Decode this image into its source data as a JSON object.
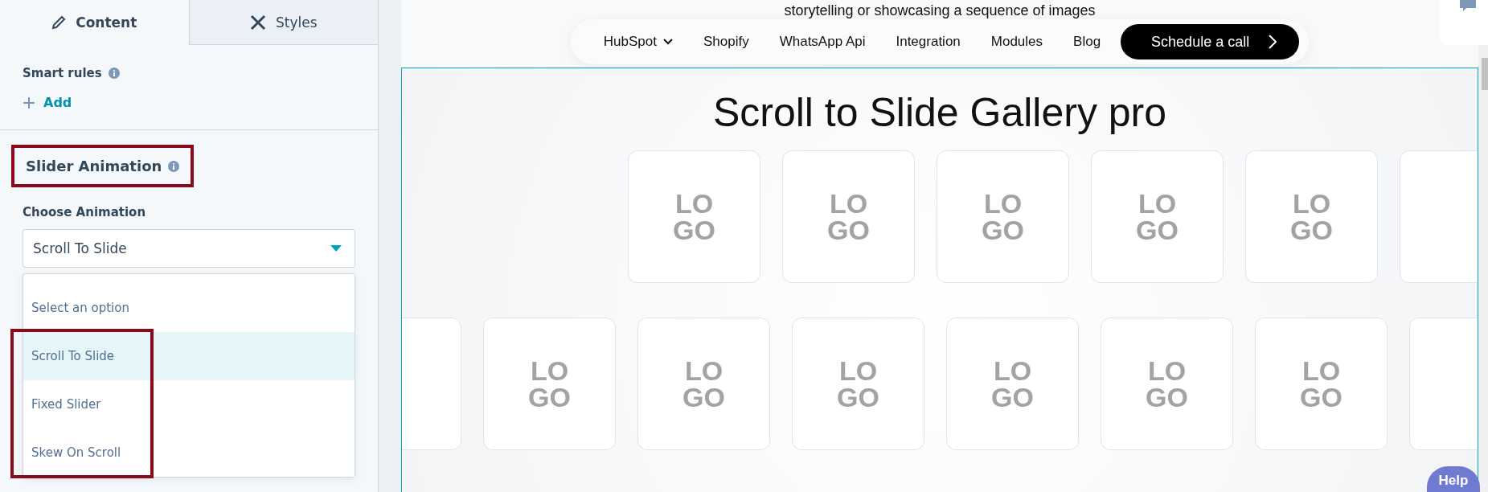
{
  "sidebar": {
    "tabs": [
      {
        "label": "Content",
        "selected": true
      },
      {
        "label": "Styles",
        "selected": false
      }
    ],
    "smart_rules": {
      "label": "Smart rules",
      "action": "Add"
    },
    "section": {
      "title": "Slider Animation",
      "highlighted": true
    },
    "field": {
      "label": "Choose Animation",
      "value": "Scroll To Slide",
      "expanded": true,
      "options": [
        {
          "label": "Select an option",
          "selected": false,
          "highlighted": false
        },
        {
          "label": "Scroll To Slide",
          "selected": true,
          "highlighted": true
        },
        {
          "label": "Fixed Slider",
          "selected": false,
          "highlighted": true
        },
        {
          "label": "Skew On Scroll",
          "selected": false,
          "highlighted": true
        }
      ]
    }
  },
  "preview": {
    "intro_text": "storytelling or showcasing a sequence of images",
    "nav": [
      {
        "label": "HubSpot",
        "kind": "dropdown"
      },
      {
        "label": "Shopify",
        "kind": "link"
      },
      {
        "label": "WhatsApp Api",
        "kind": "link"
      },
      {
        "label": "Integration",
        "kind": "link"
      },
      {
        "label": "Modules",
        "kind": "link"
      },
      {
        "label": "Blog",
        "kind": "link"
      }
    ],
    "cta": "Schedule a call",
    "title": "Scroll to Slide Gallery pro",
    "upper_strip": {
      "logos": [
        "LO GO",
        "LO GO",
        "LO GO",
        "LO GO",
        "LO GO"
      ]
    },
    "lower_strip": {
      "logos": [
        "LO GO",
        "LO GO",
        "LO GO",
        "LO GO",
        "LO GO",
        "LO GO"
      ]
    },
    "help": "Help"
  }
}
